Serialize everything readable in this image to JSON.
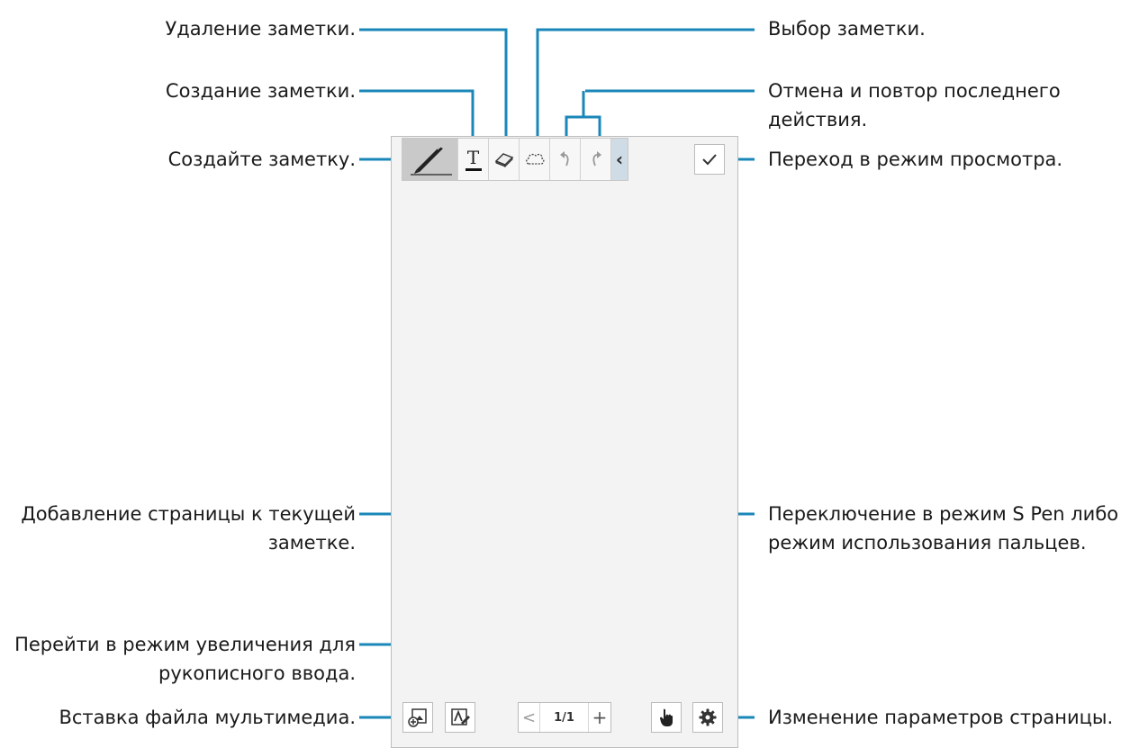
{
  "labels": {
    "delete_note": "Удаление заметки.",
    "create_note_text": "Создание заметки.",
    "create_note": "Создайте заметку.",
    "select_note": "Выбор заметки.",
    "undo_redo_line1": "Отмена и повтор последнего",
    "undo_redo_line2": "действия.",
    "view_mode": "Переход в режим просмотра.",
    "add_page_line1": "Добавление страницы к текущей",
    "add_page_line2": "заметке.",
    "zoom_line1": "Перейти в режим увеличения для",
    "zoom_line2": "рукописного ввода.",
    "insert_media": "Вставка файла мультимедиа.",
    "pen_mode_line1": "Переключение в режим S Pen либо",
    "pen_mode_line2": "режим использования пальцев.",
    "page_settings": "Изменение параметров страницы."
  },
  "toolbar": {
    "text_tool_glyph": "T",
    "collapse_glyph": "‹",
    "done_glyph": "✓"
  },
  "pager": {
    "prev": "<",
    "page": "1/1",
    "add": "+"
  },
  "icons": [
    "pen-icon",
    "text-icon",
    "eraser-icon",
    "lasso-icon",
    "undo-icon",
    "redo-icon",
    "collapse-icon",
    "check-icon",
    "insert-media-icon",
    "zoom-pen-icon",
    "hand-icon",
    "gear-icon"
  ],
  "colors": {
    "callout_line": "#1a87b8",
    "toolbar_selected": "#c9c9c9",
    "collapse_bg": "#cfdbe5"
  }
}
